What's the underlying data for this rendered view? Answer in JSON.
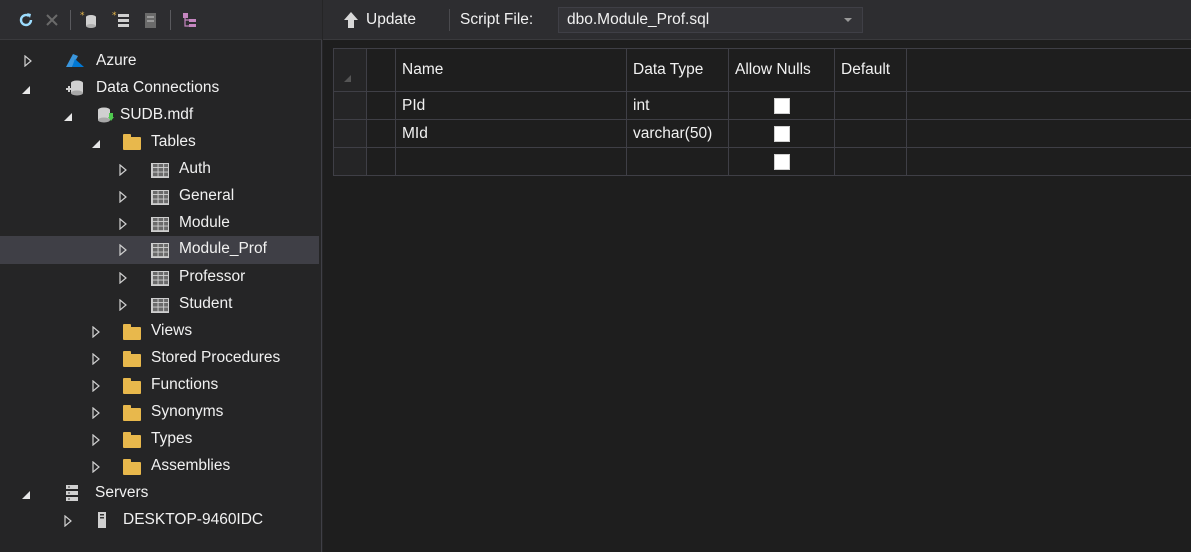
{
  "explorer": {
    "toolbar_icons": [
      "refresh-icon",
      "stop-icon",
      "connect-database-icon",
      "connect-server-icon",
      "add-sharepoint-icon",
      "properties-icon"
    ],
    "tree": [
      {
        "label": "Azure",
        "icon": "azure-icon",
        "expander": "closed"
      },
      {
        "label": "Data Connections",
        "icon": "data-connections-icon",
        "expander": "open"
      },
      {
        "label": "SUDB.mdf",
        "icon": "database-icon",
        "expander": "open"
      },
      {
        "label": "Tables",
        "icon": "folder-icon",
        "expander": "open"
      },
      {
        "label": "Auth",
        "icon": "table-icon",
        "expander": "closed"
      },
      {
        "label": "General",
        "icon": "table-icon",
        "expander": "closed"
      },
      {
        "label": "Module",
        "icon": "table-icon",
        "expander": "closed"
      },
      {
        "label": "Module_Prof",
        "icon": "table-icon",
        "expander": "closed",
        "selected": true
      },
      {
        "label": "Professor",
        "icon": "table-icon",
        "expander": "closed"
      },
      {
        "label": "Student",
        "icon": "table-icon",
        "expander": "closed"
      },
      {
        "label": "Views",
        "icon": "folder-icon",
        "expander": "closed"
      },
      {
        "label": "Stored Procedures",
        "icon": "folder-icon",
        "expander": "closed"
      },
      {
        "label": "Functions",
        "icon": "folder-icon",
        "expander": "closed"
      },
      {
        "label": "Synonyms",
        "icon": "folder-icon",
        "expander": "closed"
      },
      {
        "label": "Types",
        "icon": "folder-icon",
        "expander": "closed"
      },
      {
        "label": "Assemblies",
        "icon": "folder-icon",
        "expander": "closed"
      },
      {
        "label": "Servers",
        "icon": "servers-icon",
        "expander": "open"
      },
      {
        "label": "DESKTOP-9460IDC",
        "icon": "server-icon",
        "expander": "closed"
      }
    ]
  },
  "designer": {
    "update_label": "Update",
    "script_file_label": "Script File:",
    "script_file_value": "dbo.Module_Prof.sql",
    "columns": [
      "Name",
      "Data Type",
      "Allow Nulls",
      "Default"
    ],
    "rows": [
      {
        "name": "PId",
        "data_type": "int",
        "allow_nulls": false,
        "default": ""
      },
      {
        "name": "MId",
        "data_type": "varchar(50)",
        "allow_nulls": false,
        "default": ""
      },
      {
        "name": "",
        "data_type": "",
        "allow_nulls": false,
        "default": ""
      }
    ]
  },
  "colors": {
    "background": "#1e1e1e",
    "panel": "#252526",
    "toolbar": "#2d2d30",
    "selection": "#3f3f46",
    "azure": "#3a96dd",
    "folder": "#e8b84c"
  }
}
